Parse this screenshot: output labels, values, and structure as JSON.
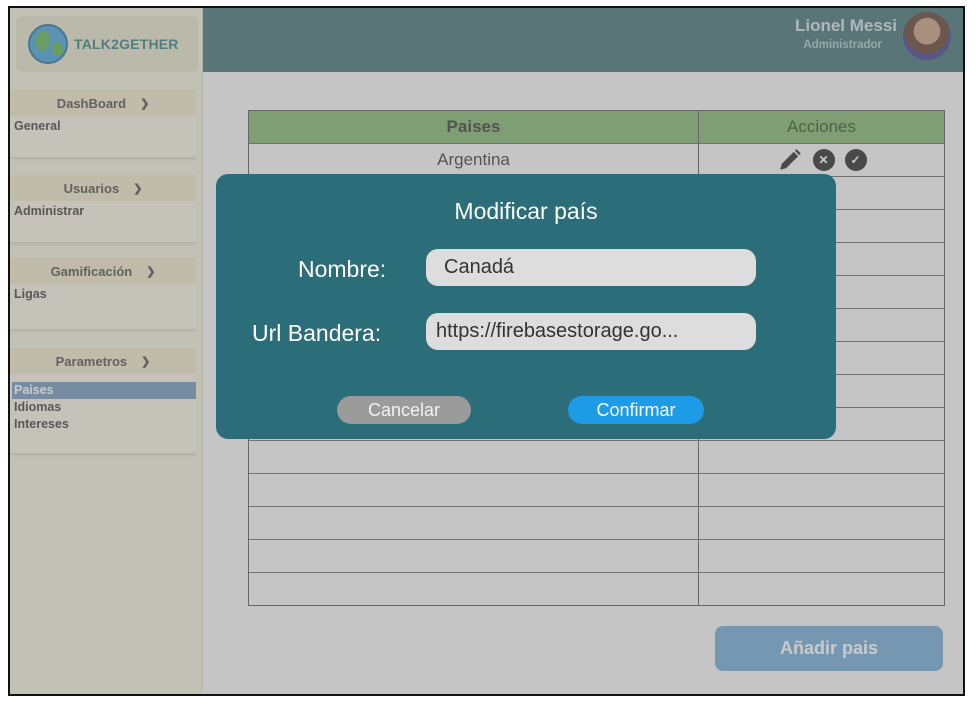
{
  "brand": {
    "name": "TALK2GETHER"
  },
  "user": {
    "name": "Lionel Messi",
    "role": "Administrador"
  },
  "sidebar": {
    "sections": [
      {
        "title": "DashBoard",
        "items": [
          "General"
        ]
      },
      {
        "title": "Usuarios",
        "items": [
          "Administrar"
        ]
      },
      {
        "title": "Gamificación",
        "items": [
          "Ligas"
        ]
      },
      {
        "title": "Parametros",
        "items": [
          "Paises",
          "Idiomas",
          "Intereses"
        ],
        "active_item": "Paises"
      }
    ]
  },
  "table": {
    "headers": [
      "Paises",
      "Acciones"
    ],
    "rows": [
      [
        "Argentina",
        ""
      ]
    ]
  },
  "add_button": "Añadir pais",
  "modal": {
    "title": "Modificar país",
    "name_label": "Nombre:",
    "name_value": "Canadá",
    "url_label": "Url Bandera:",
    "url_value": "https://firebasestorage.go...",
    "cancel_label": "Cancelar",
    "confirm_label": "Confirmar"
  },
  "icons": {
    "edit": "pencil-icon",
    "delete": "close-circle-icon",
    "approve": "check-circle-icon",
    "expand": "chevron-down-icon"
  },
  "colors": {
    "header": "#3d6d72",
    "modal": "#2b6e7a",
    "table_header": "#7eb36c",
    "confirm": "#1e9be6",
    "cancel": "#9b9b9b",
    "add_button": "#6fa8d6"
  }
}
